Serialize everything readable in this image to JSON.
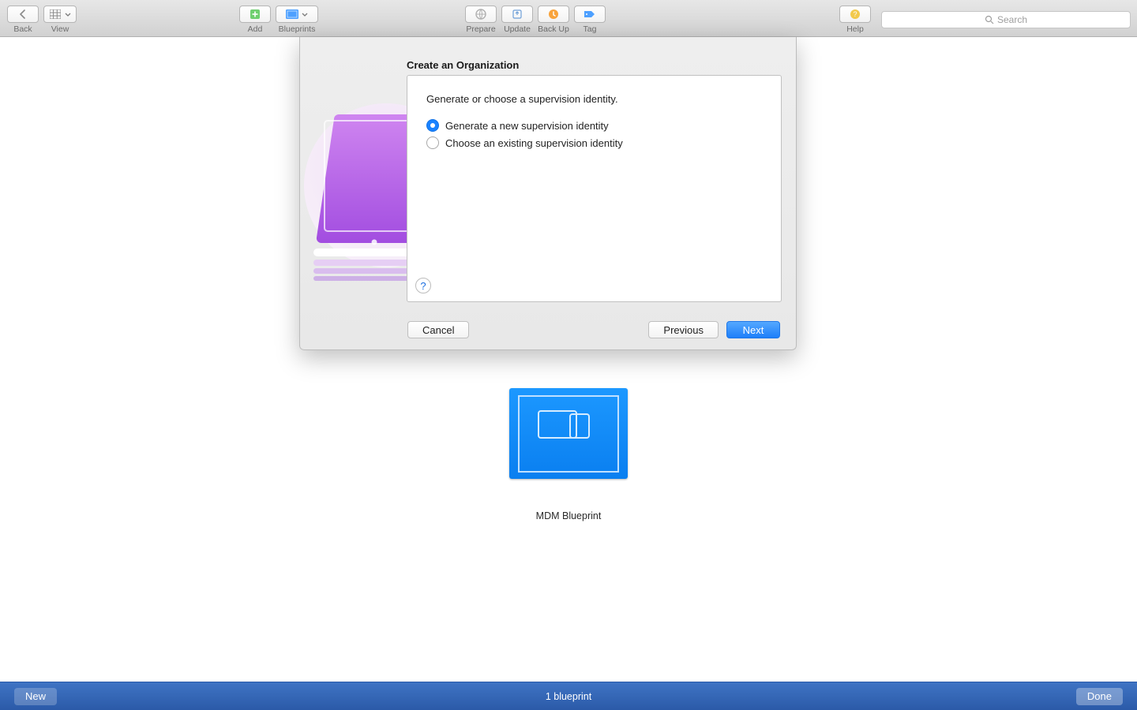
{
  "toolbar": {
    "back_label": "Back",
    "view_label": "View",
    "add_label": "Add",
    "blueprints_label": "Blueprints",
    "prepare_label": "Prepare",
    "update_label": "Update",
    "backup_label": "Back Up",
    "tag_label": "Tag",
    "help_label": "Help",
    "search_placeholder": "Search"
  },
  "blueprint": {
    "name": "MDM Blueprint"
  },
  "sheet": {
    "title": "Create an Organization",
    "instruction": "Generate or choose a supervision identity.",
    "option_generate": "Generate a new supervision identity",
    "option_choose": "Choose an existing supervision identity",
    "help_glyph": "?",
    "cancel": "Cancel",
    "previous": "Previous",
    "next": "Next"
  },
  "bottom": {
    "new": "New",
    "status": "1 blueprint",
    "done": "Done"
  },
  "colors": {
    "accent_blue": "#1d7ff9",
    "bottom_bar": "#2b5aa8"
  }
}
